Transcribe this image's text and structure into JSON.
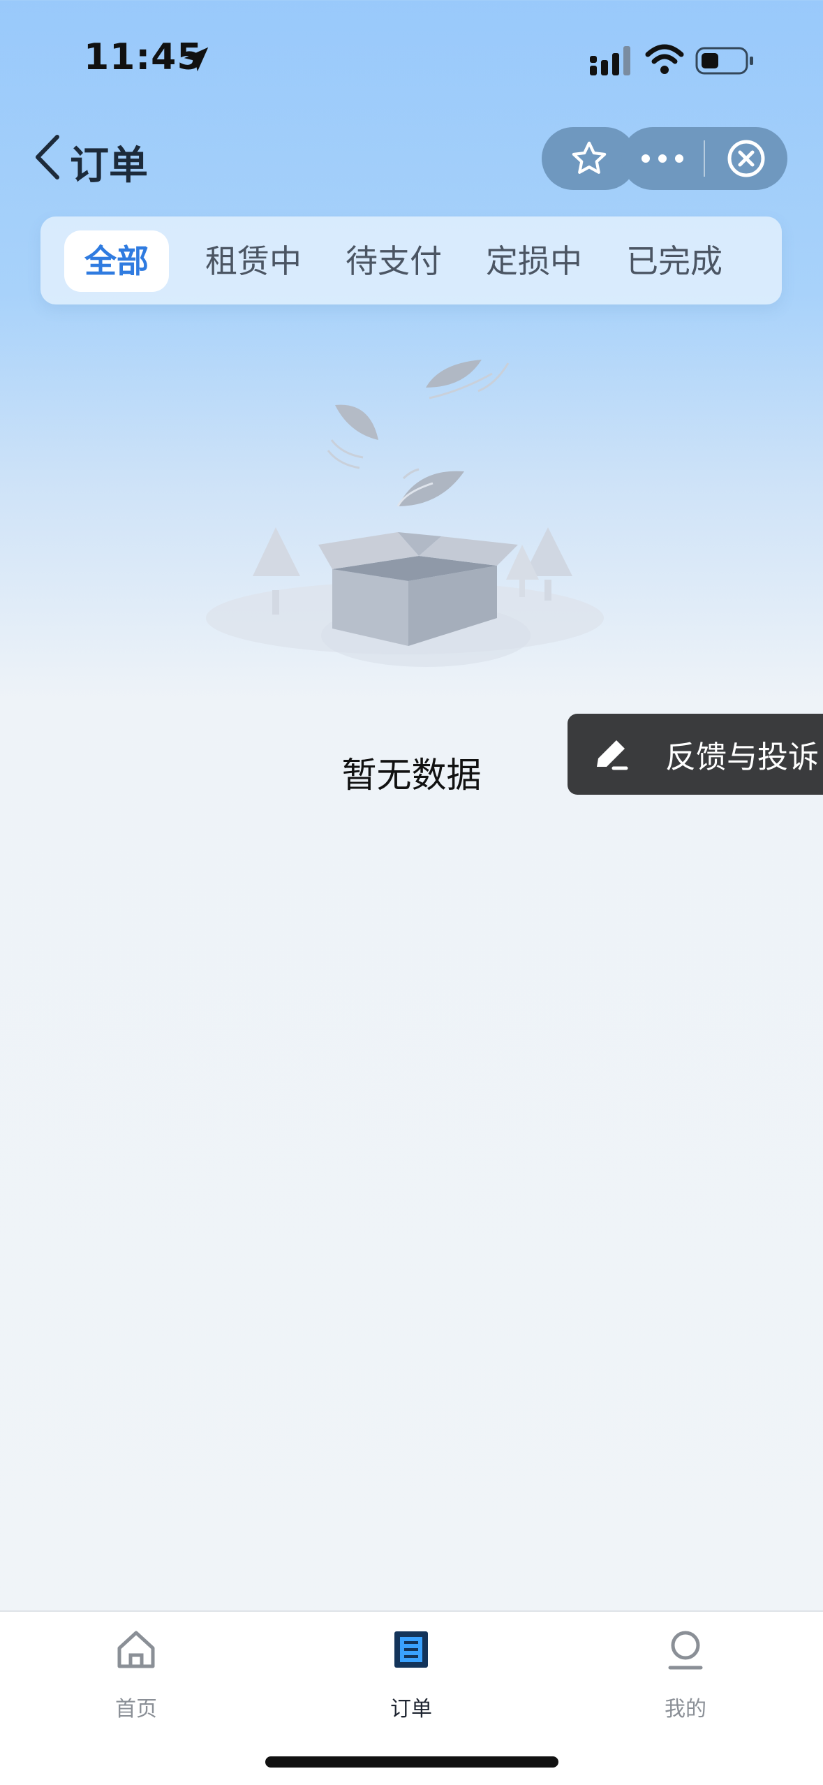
{
  "status_bar": {
    "time": "11:45"
  },
  "nav": {
    "back_icon": "chevron-left-icon",
    "title": "订单",
    "star_icon": "star-icon",
    "more_icon": "more-icon",
    "close_icon": "close-circle-icon"
  },
  "tabs": [
    {
      "label": "全部",
      "active": true
    },
    {
      "label": "租赁中",
      "active": false
    },
    {
      "label": "待支付",
      "active": false
    },
    {
      "label": "定损中",
      "active": false
    },
    {
      "label": "已完成",
      "active": false
    }
  ],
  "empty": {
    "text": "暂无数据",
    "illustration": "empty-box-illustration"
  },
  "feedback": {
    "label": "反馈与投诉",
    "icon": "pen-icon"
  },
  "bottom_nav": [
    {
      "label": "首页",
      "icon": "home-icon",
      "active": false
    },
    {
      "label": "订单",
      "icon": "order-icon",
      "active": true
    },
    {
      "label": "我的",
      "icon": "user-icon",
      "active": false
    }
  ],
  "colors": {
    "accent": "#2f7be0",
    "capsule": "#6f98bf",
    "feedback_bg": "#3a3b3d"
  }
}
